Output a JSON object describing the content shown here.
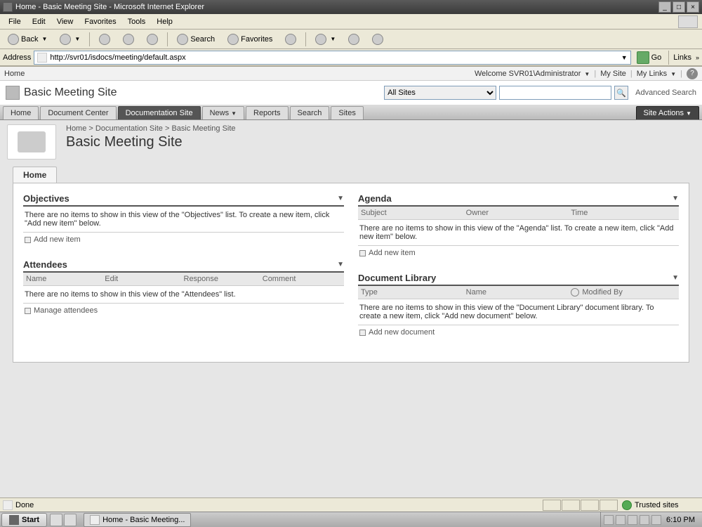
{
  "window": {
    "title": "Home - Basic Meeting Site - Microsoft Internet Explorer"
  },
  "menus": {
    "file": "File",
    "edit": "Edit",
    "view": "View",
    "favorites": "Favorites",
    "tools": "Tools",
    "help": "Help"
  },
  "toolbar": {
    "back": "Back",
    "search": "Search",
    "favorites": "Favorites"
  },
  "address": {
    "label": "Address",
    "url": "http://svr01/isdocs/meeting/default.aspx",
    "go": "Go",
    "links": "Links"
  },
  "sp": {
    "home_link": "Home",
    "welcome": "Welcome SVR01\\Administrator",
    "mysite": "My Site",
    "mylinks": "My Links",
    "site_title": "Basic Meeting Site",
    "search_scope": "All Sites",
    "advanced": "Advanced Search",
    "tabs": {
      "home": "Home",
      "doccenter": "Document Center",
      "docsite": "Documentation Site",
      "news": "News",
      "reports": "Reports",
      "search": "Search",
      "sites": "Sites"
    },
    "site_actions": "Site Actions",
    "crumbs": {
      "home": "Home",
      "docsite": "Documentation Site",
      "bms": "Basic Meeting Site"
    },
    "page_title": "Basic Meeting Site",
    "subtab": "Home",
    "objectives": {
      "title": "Objectives",
      "empty": "There are no items to show in this view of the \"Objectives\" list. To create a new item, click \"Add new item\" below.",
      "add": "Add new item"
    },
    "attendees": {
      "title": "Attendees",
      "cols": {
        "name": "Name",
        "edit": "Edit",
        "response": "Response",
        "comment": "Comment"
      },
      "empty": "There are no items to show in this view of the \"Attendees\" list.",
      "manage": "Manage attendees"
    },
    "agenda": {
      "title": "Agenda",
      "cols": {
        "subject": "Subject",
        "owner": "Owner",
        "time": "Time"
      },
      "empty": "There are no items to show in this view of the \"Agenda\" list. To create a new item, click \"Add new item\" below.",
      "add": "Add new item"
    },
    "doclib": {
      "title": "Document Library",
      "cols": {
        "type": "Type",
        "name": "Name",
        "modifiedby": "Modified By"
      },
      "empty": "There are no items to show in this view of the \"Document Library\" document library. To create a new item, click \"Add new document\" below.",
      "add": "Add new document"
    }
  },
  "status": {
    "done": "Done",
    "trusted": "Trusted sites"
  },
  "taskbar": {
    "start": "Start",
    "task": "Home - Basic Meeting...",
    "clock": "6:10 PM"
  }
}
